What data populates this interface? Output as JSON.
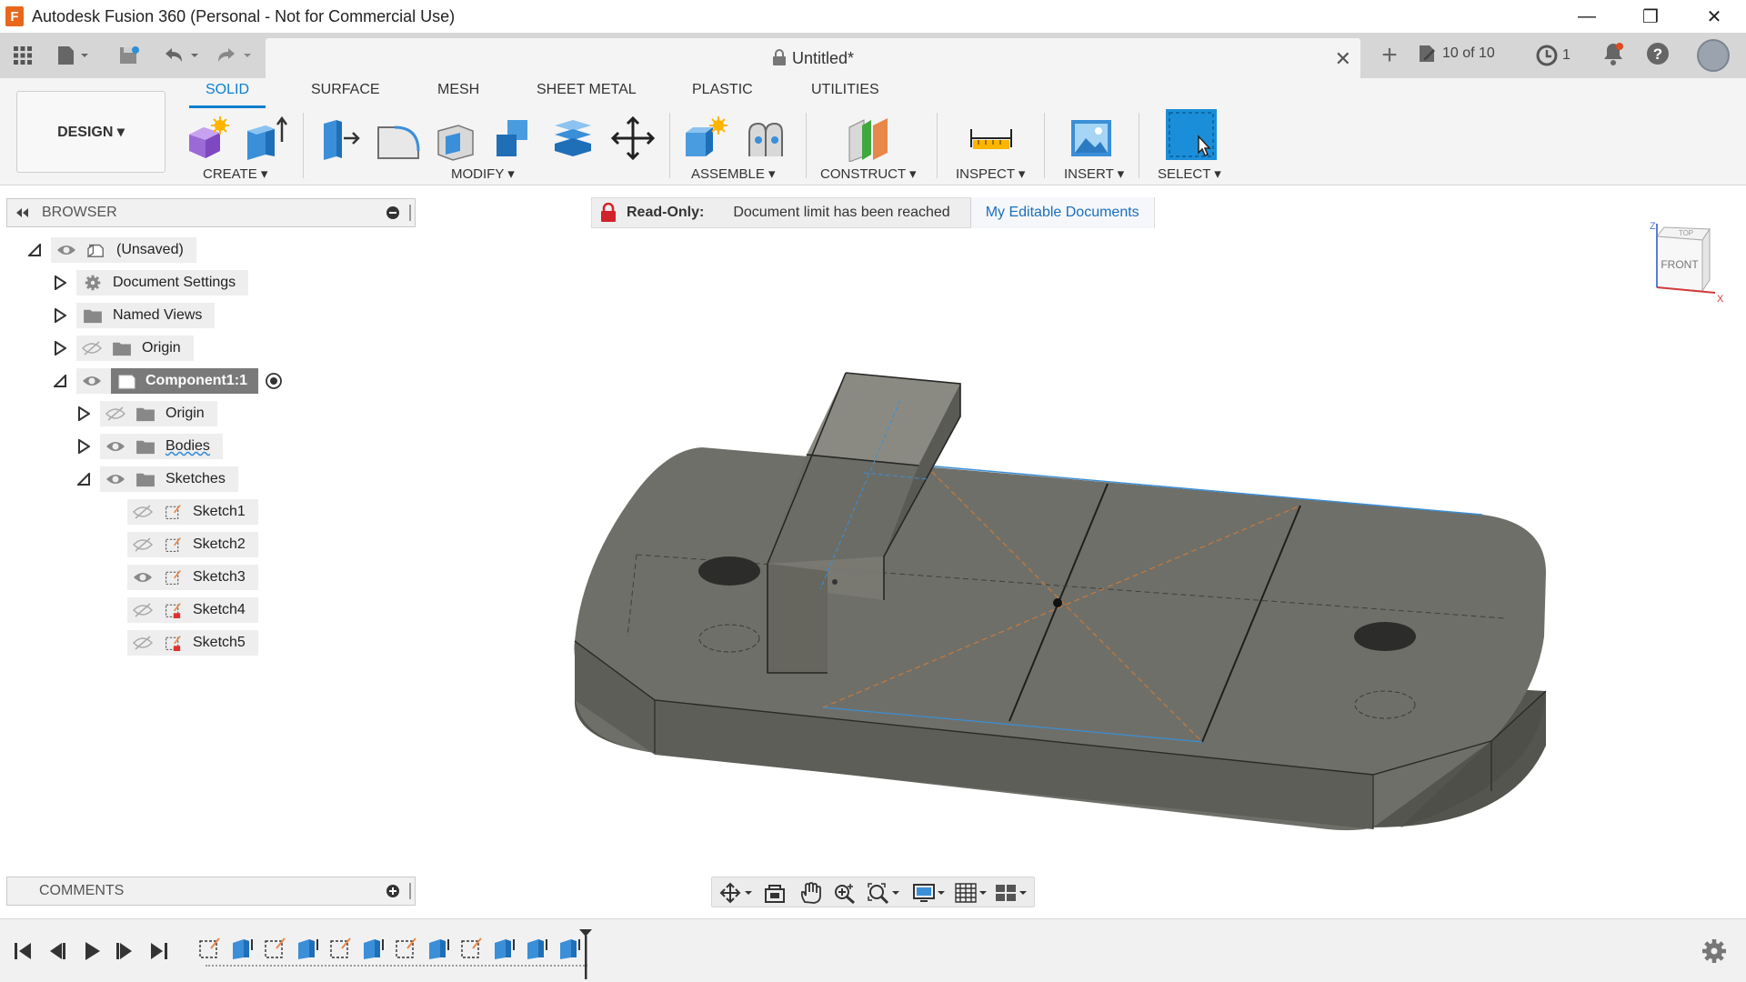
{
  "titlebar": {
    "logo_letter": "F",
    "title": "Autodesk Fusion 360 (Personal - Not for Commercial Use)",
    "minimize": "—",
    "restore": "❐",
    "close": "✕"
  },
  "tabrow": {
    "doc_title": "Untitled*",
    "close_label": "✕",
    "new_tab": "+",
    "jobs": "10 of 10",
    "history_count": "1"
  },
  "ribbon": {
    "workspace": "DESIGN ▾",
    "tabs": [
      "SOLID",
      "SURFACE",
      "MESH",
      "SHEET METAL",
      "PLASTIC",
      "UTILITIES"
    ],
    "groups": [
      "CREATE ▾",
      "MODIFY ▾",
      "ASSEMBLE ▾",
      "CONSTRUCT ▾",
      "INSPECT ▾",
      "INSERT ▾",
      "SELECT ▾"
    ]
  },
  "browser": {
    "title": "BROWSER",
    "rows": [
      {
        "label": "(Unsaved)"
      },
      {
        "label": "Document Settings"
      },
      {
        "label": "Named Views"
      },
      {
        "label": "Origin"
      },
      {
        "label": "Component1:1"
      },
      {
        "label": "Origin"
      },
      {
        "label": "Bodies"
      },
      {
        "label": "Sketches"
      },
      {
        "label": "Sketch1"
      },
      {
        "label": "Sketch2"
      },
      {
        "label": "Sketch3"
      },
      {
        "label": "Sketch4"
      },
      {
        "label": "Sketch5"
      }
    ]
  },
  "banner": {
    "readonly": "Read-Only:",
    "message": "Document limit has been reached",
    "link": "My Editable Documents"
  },
  "comments": {
    "title": "COMMENTS"
  },
  "viewcube": {
    "top": "TOP",
    "front": "FRONT",
    "z": "Z",
    "x": "X"
  },
  "colors": {
    "accent": "#0b7fcf",
    "model_face": "#6e6e68",
    "model_side": "#5a5a54"
  }
}
